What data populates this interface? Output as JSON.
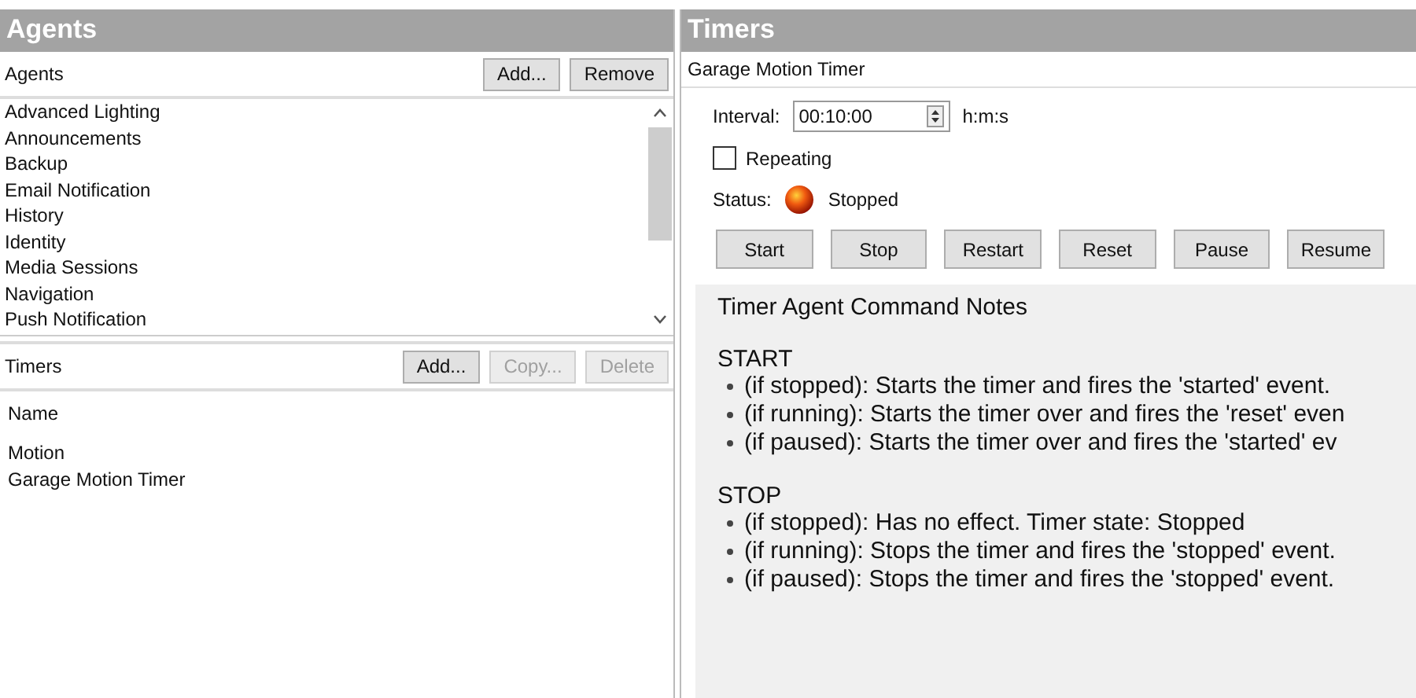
{
  "agents_panel": {
    "title": "Agents",
    "agents": {
      "label": "Agents",
      "buttons": [
        {
          "label": "Add...",
          "disabled": false
        },
        {
          "label": "Remove",
          "disabled": false
        }
      ],
      "items": [
        "Advanced Lighting",
        "Announcements",
        "Backup",
        "Email Notification",
        "History",
        "Identity",
        "Media Sessions",
        "Navigation",
        "Push Notification"
      ]
    },
    "timers": {
      "label": "Timers",
      "buttons": [
        {
          "label": "Add...",
          "disabled": false
        },
        {
          "label": "Copy...",
          "disabled": true
        },
        {
          "label": "Delete",
          "disabled": true
        }
      ],
      "column": "Name",
      "items": [
        "Motion",
        "Garage Motion Timer"
      ]
    }
  },
  "timers_panel": {
    "title": "Timers",
    "subtitle": "Garage Motion Timer",
    "interval": {
      "label": "Interval:",
      "value": "00:10:00",
      "unit": "h:m:s"
    },
    "repeating": {
      "label": "Repeating",
      "checked": false
    },
    "status": {
      "label": "Status:",
      "value": "Stopped"
    },
    "buttons": [
      "Start",
      "Stop",
      "Restart",
      "Reset",
      "Pause",
      "Resume"
    ],
    "notes": {
      "title": "Timer Agent Command Notes",
      "sections": [
        {
          "heading": "START",
          "items": [
            "(if stopped):  Starts the timer and fires the 'started' event.",
            "(if running):  Starts the timer over and fires the 'reset' even",
            "(if paused):  Starts the timer over and fires the 'started' ev"
          ]
        },
        {
          "heading": "STOP",
          "items": [
            "(if stopped):  Has no effect. Timer state: Stopped",
            "(if running):  Stops the timer and fires the 'stopped' event.",
            "(if paused):  Stops the timer and fires the 'stopped' event."
          ]
        }
      ]
    }
  }
}
